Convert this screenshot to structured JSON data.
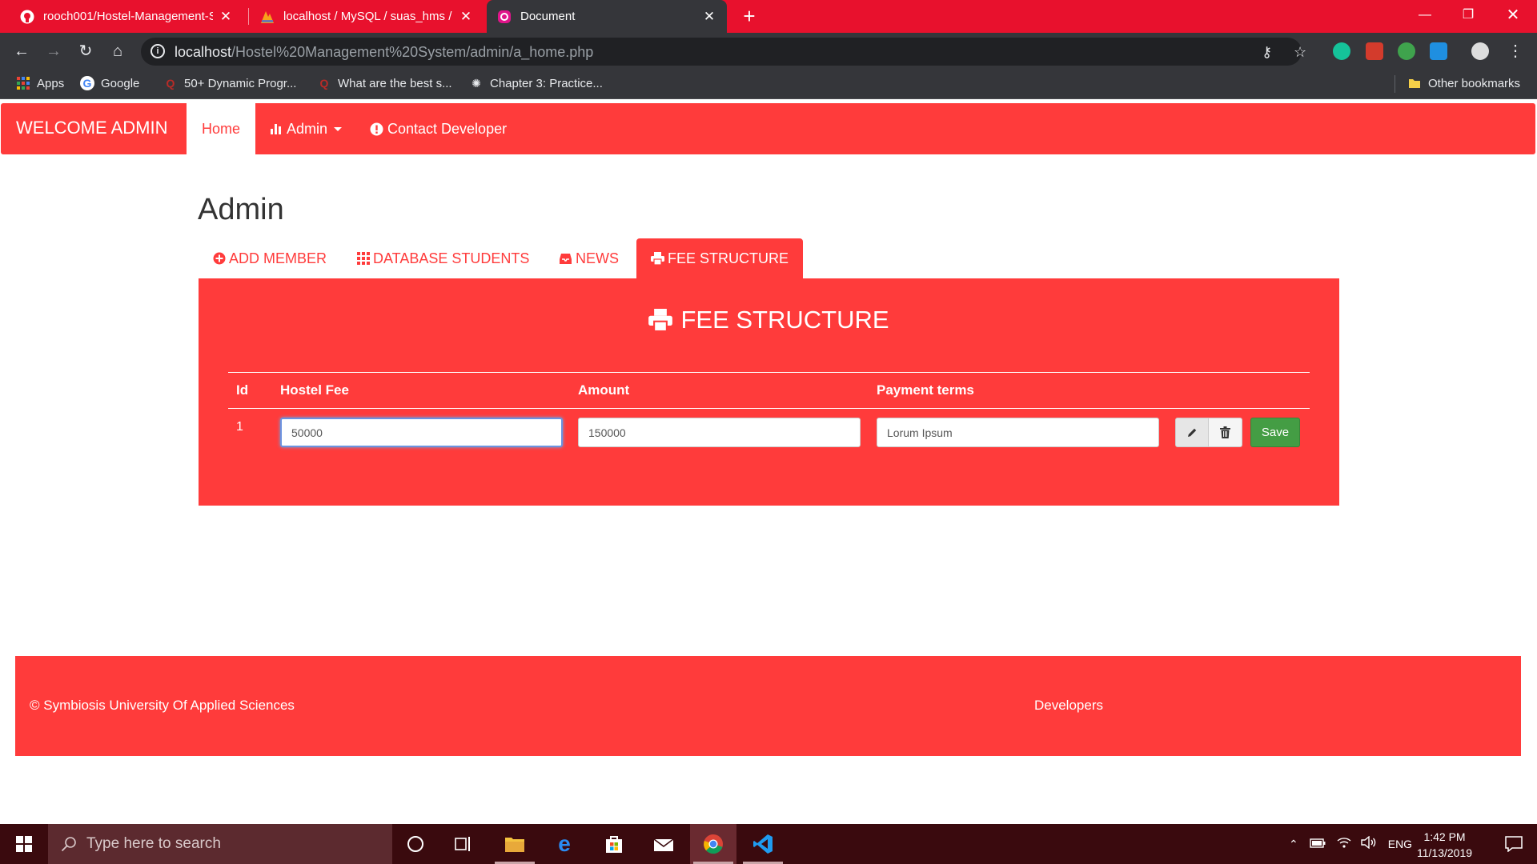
{
  "browser": {
    "tabs": [
      {
        "title": "rooch001/Hostel-Management-S",
        "active": false
      },
      {
        "title": "localhost / MySQL / suas_hms / f",
        "active": false
      },
      {
        "title": "Document",
        "active": true
      }
    ],
    "url_host": "localhost",
    "url_path": "/Hostel%20Management%20System/admin/a_home.php",
    "bookmarks": [
      {
        "label": "Apps",
        "icon": "apps-grid-icon"
      },
      {
        "label": "Google",
        "icon": "google-icon"
      },
      {
        "label": "50+ Dynamic Progr...",
        "icon": "quora-icon"
      },
      {
        "label": "What are the best s...",
        "icon": "quora-icon"
      },
      {
        "label": "Chapter 3: Practice...",
        "icon": "site-icon"
      }
    ],
    "other_bookmarks": "Other bookmarks"
  },
  "navbar": {
    "brand": "WELCOME ADMIN",
    "home": "Home",
    "admin": "Admin",
    "contact": "Contact Developer"
  },
  "page": {
    "title": "Admin",
    "tabs": {
      "add_member": "ADD MEMBER",
      "database_students": "DATABASE STUDENTS",
      "news": "NEWS",
      "fee_structure": "FEE STRUCTURE"
    },
    "panel_title": "FEE STRUCTURE",
    "table": {
      "headers": [
        "Id",
        "Hostel Fee",
        "Amount",
        "Payment terms"
      ],
      "rows": [
        {
          "id": "1",
          "hostel_fee": "50000",
          "amount": "150000",
          "payment_terms": "Lorum Ipsum"
        }
      ],
      "save_label": "Save"
    }
  },
  "footer": {
    "copyright": "© Symbiosis University Of Applied Sciences",
    "developers": "Developers"
  },
  "taskbar": {
    "search_placeholder": "Type here to search",
    "language": "ENG",
    "time": "1:42 PM",
    "date": "11/13/2019"
  },
  "colors": {
    "brand_red": "#ff3b3b",
    "chrome_red": "#e8112d",
    "save_green": "#449d44"
  }
}
